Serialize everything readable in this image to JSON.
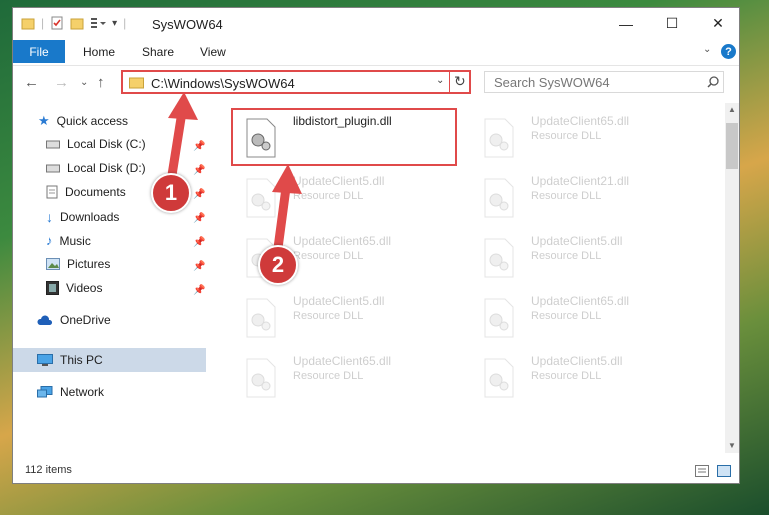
{
  "window": {
    "title": "SysWOW64",
    "minimize": "—",
    "maximize": "☐",
    "close": "✕"
  },
  "ribbon": {
    "tabs": [
      "File",
      "Home",
      "Share",
      "View"
    ],
    "help": "?"
  },
  "address_bar": {
    "path": "C:\\Windows\\SysWOW64",
    "refresh_icon": "↻"
  },
  "search": {
    "placeholder": "Search SysWOW64"
  },
  "sidebar": {
    "items": [
      {
        "label": "Quick access"
      },
      {
        "label": "Local Disk (C:)"
      },
      {
        "label": "Local Disk (D:)"
      },
      {
        "label": "Documents"
      },
      {
        "label": "Downloads"
      },
      {
        "label": "Music"
      },
      {
        "label": "Pictures"
      },
      {
        "label": "Videos"
      },
      {
        "label": "OneDrive"
      },
      {
        "label": "This PC"
      },
      {
        "label": "Network"
      }
    ]
  },
  "files": [
    {
      "name": "libdistort_plugin.dll",
      "type": ""
    },
    {
      "name": "UpdateClient65.dll",
      "type": "Resource DLL"
    },
    {
      "name": "UpdateClient5.dll",
      "type": "Resource DLL"
    },
    {
      "name": "UpdateClient21.dll",
      "type": "Resource DLL"
    },
    {
      "name": "UpdateClient65.dll",
      "type": "Resource DLL"
    },
    {
      "name": "UpdateClient5.dll",
      "type": "Resource DLL"
    },
    {
      "name": "UpdateClient5.dll",
      "type": "Resource DLL"
    },
    {
      "name": "UpdateClient65.dll",
      "type": "Resource DLL"
    },
    {
      "name": "UpdateClient65.dll",
      "type": "Resource DLL"
    },
    {
      "name": "UpdateClient5.dll",
      "type": "Resource DLL"
    }
  ],
  "status": {
    "item_count": "112 items"
  },
  "annotations": {
    "step1": "1",
    "step2": "2"
  },
  "colors": {
    "accent": "#1979ca",
    "highlight": "#e04a4a",
    "selected": "#ccd9e8"
  }
}
